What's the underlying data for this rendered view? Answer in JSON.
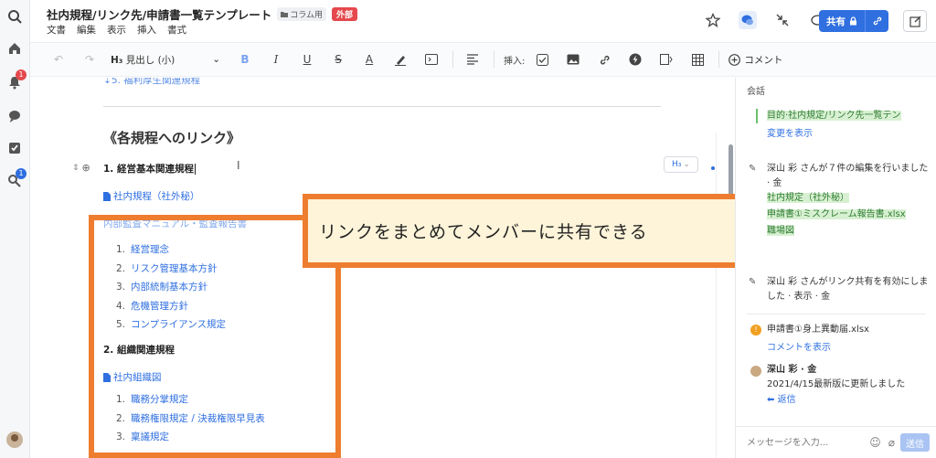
{
  "rail": {
    "notif_badge": "1",
    "search_badge": "1"
  },
  "header": {
    "title": "社内規程/リンク先/申請書一覧テンプレート",
    "folder": "コラム用",
    "external_tag": "外部",
    "menu": [
      "文書",
      "編集",
      "表示",
      "挿入",
      "書式"
    ],
    "share_label": "共有"
  },
  "toolbar": {
    "heading_select": "見出し (小)",
    "insert_label": "挿入:",
    "comment_label": "コメント"
  },
  "editor": {
    "top_link": "5. 福利厚生関連規程",
    "heading": "《各規程へのリンク》",
    "section1": "1. 経営基本関連規程",
    "section1_doc": "社内規程（社外秘）",
    "partial_hidden_link": "内部監査マニュアル・監査報告書",
    "list1": [
      "経営理念",
      "リスク管理基本方針",
      "内部統制基本方針",
      "危機管理方針",
      "コンプライアンス規定"
    ],
    "section2": "2. 組織関連規程",
    "section2_doc": "社内組織図",
    "list2": [
      "職務分掌規定",
      "職務権限規定 / 決裁権限早見表",
      "稟議規定"
    ],
    "h_chip": "H₃",
    "callout": "リンクをまとめてメンバーに共有できる"
  },
  "panel": {
    "title": "会話",
    "act1_text": "目的·社内規定/リンク先一覧テン",
    "act1_link": "変更を表示",
    "act2_text": "深山 彩 さんが７件の編集を行いました · 金",
    "act2_item1": "社内規定（社外秘）",
    "act2_item2": "申請書①ミスクレーム報告書.xlsx",
    "act2_item3": "職場図",
    "act3_text": "深山 彩 さんがリンク共有を有効にしました · 表示 · 金",
    "comment_file": "申請書①身上異動届.xlsx",
    "comment_link": "コメントを表示",
    "comment_author": "深山 彩 · 金",
    "comment_body": "2021/4/15最新版に更新しました",
    "reply_label": "返信",
    "input_placeholder": "メッセージを入力...",
    "send_label": "送信"
  },
  "colors": {
    "accent": "#2f6fe0",
    "highlight": "#ee7d2f",
    "badge": "#e5484d"
  }
}
